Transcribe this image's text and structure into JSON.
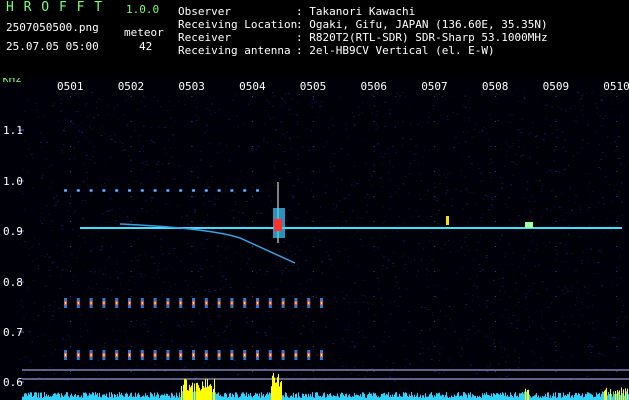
{
  "header": {
    "app_title": "H R O F F T",
    "version": "1.0.0",
    "filename": "2507050500.png",
    "datetime": "25.07.05 05:00",
    "count_label": "meteor",
    "count_value": "42",
    "info": [
      {
        "key": "Observer",
        "value": ": Takanori Kawachi"
      },
      {
        "key": "Receiving Location",
        "value": ": Ogaki, Gifu, JAPAN (136.60E, 35.35N)"
      },
      {
        "key": "Receiver",
        "value": ": R820T2(RTL-SDR) SDR-Sharp 53.1000MHz"
      },
      {
        "key": "Receiving antenna",
        "value": ": 2el-HB9CV Vertical (el. E-W)"
      }
    ]
  },
  "plot": {
    "unit": "kHz",
    "time_ticks": [
      "0501",
      "0502",
      "0503",
      "0504",
      "0505",
      "0506",
      "0507",
      "0508",
      "0509",
      "0510"
    ],
    "freq_ticks": [
      "1.1",
      "1.0",
      "0.9",
      "0.8",
      "0.7",
      "0.6"
    ],
    "colors": {
      "text": "#7CFC7C",
      "carrier": "#40e0ff",
      "histogram": "#ffff00"
    }
  }
}
